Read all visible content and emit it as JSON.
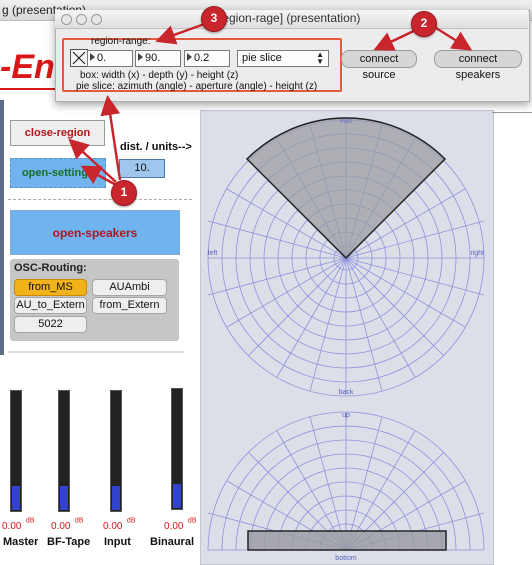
{
  "main_window": {
    "title": "g (presentation)"
  },
  "left_panel": {
    "app_title": "-Eng",
    "close_region_label": "close-region",
    "open_settings_label": "open-settings",
    "dist_label": "dist. / units-->",
    "dist_value": "10.",
    "open_speakers_label": "open-speakers",
    "osc": {
      "title": "OSC-Routing:",
      "from_ms": "from_MS",
      "auambi": "AUAmbi",
      "au_to_extern": "AU_to_Extern",
      "from_extern": "from_Extern",
      "port": "5022"
    },
    "faders": [
      {
        "value": "0.00",
        "unit": "dB",
        "name": "Master",
        "level": 0.2
      },
      {
        "value": "0.00",
        "unit": "dB",
        "name": "BF-Tape",
        "level": 0.2
      },
      {
        "value": "0.00",
        "unit": "dB",
        "name": "Input",
        "level": 0.2
      },
      {
        "value": "0.00",
        "unit": "dB",
        "name": "Binaural",
        "level": 0.2
      }
    ]
  },
  "pan_view": {
    "top_plot": {
      "label_front": "front",
      "label_back": "back",
      "label_left": "left",
      "label_right": "right"
    },
    "bottom_plot": {
      "label_up": "up",
      "label_bottom": "bottom"
    }
  },
  "presentation_window": {
    "title": "[region-rage] (presentation)",
    "region_range_label": "region-range:",
    "x_value": "0.",
    "y_value": "90.",
    "z_value": "0.2",
    "shape_menu": "pie slice",
    "box_help": "box: width (x) - depth (y) - height (z)",
    "pie_help": "pie slice: azimuth (angle) - aperture (angle) - height (z)",
    "connect_source_label": "connect source",
    "connect_speakers_label": "connect speakers"
  },
  "annotations": [
    {
      "number": "1"
    },
    {
      "number": "2"
    },
    {
      "number": "3"
    }
  ],
  "colors": {
    "accent_red": "#d81818",
    "button_blue": "#6fb4ef",
    "osc_active": "#f2b21a",
    "annotation_red": "#c8252d"
  }
}
